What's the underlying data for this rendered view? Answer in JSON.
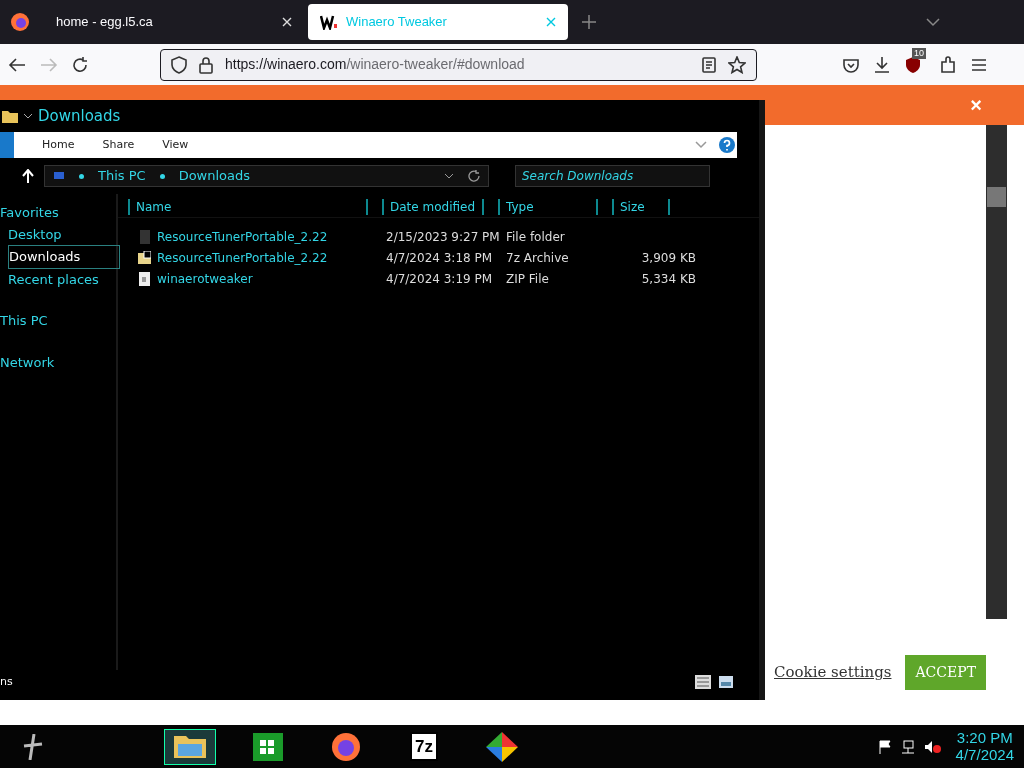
{
  "browser": {
    "tabs": [
      {
        "label": "home - egg.l5.ca",
        "selected": false
      },
      {
        "label": "Winaero Tweaker",
        "selected": true
      }
    ],
    "url": {
      "host": "https://winaero.com",
      "path": "/winaero-tweaker/#download"
    },
    "ublock_count": "10"
  },
  "page": {
    "banner_close": "×",
    "cookie_settings": "Cookie settings",
    "accept": "ACCEPT"
  },
  "explorer": {
    "title": "Downloads",
    "ribbon_tabs": [
      {
        "label": "Home",
        "selected": false
      },
      {
        "label": "Share",
        "selected": false
      },
      {
        "label": "View",
        "selected": false
      }
    ],
    "breadcrumb": [
      "This PC",
      "Downloads"
    ],
    "search": {
      "placeholder": "Search Downloads"
    },
    "nav": [
      {
        "label": "Favorites",
        "selected": false,
        "children": [
          {
            "label": "Desktop",
            "selected": false
          },
          {
            "label": "Downloads",
            "selected": true
          },
          {
            "label": "Recent places",
            "selected": false
          }
        ]
      },
      {
        "label": "This PC",
        "selected": false
      },
      {
        "label": "Network",
        "selected": false
      }
    ],
    "columns": [
      "Name",
      "Date modified",
      "Type",
      "Size"
    ],
    "files": [
      {
        "kind": "folder",
        "name": "ResourceTunerPortable_2.22",
        "date": "2/15/2023 9:27 PM",
        "type": "File folder"
      },
      {
        "kind": "archive",
        "name": "ResourceTunerPortable_2.22",
        "date": "4/7/2024 3:18 PM",
        "type": "7z Archive",
        "size": "3,909 KB"
      },
      {
        "kind": "zip",
        "name": "winaerotweaker",
        "date": "4/7/2024 3:19 PM",
        "type": "ZIP File",
        "size": "5,334 KB"
      }
    ],
    "status": "ns"
  },
  "taskbar": {
    "apps": [
      {
        "kind": "explorer",
        "selected": true
      },
      {
        "kind": "store",
        "selected": false
      },
      {
        "kind": "firefox",
        "selected": false
      },
      {
        "kind": "sevenzip",
        "label": "7z",
        "selected": false
      },
      {
        "kind": "pinwheel",
        "selected": false
      }
    ],
    "time": "3:20 PM",
    "date": "4/7/2024"
  }
}
